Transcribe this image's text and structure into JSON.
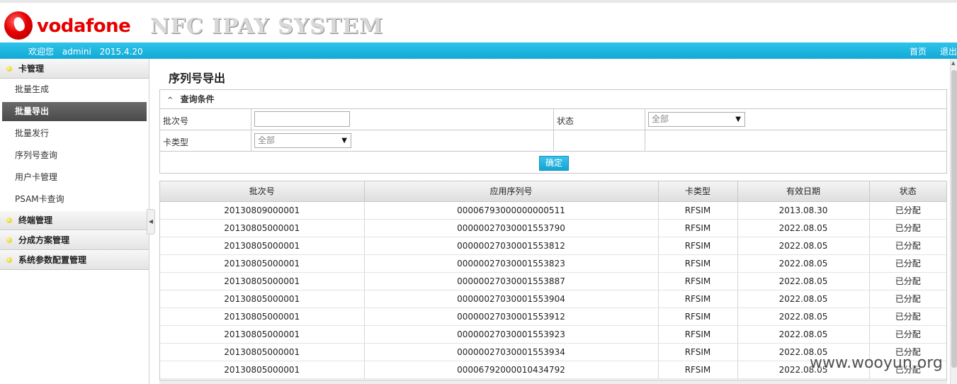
{
  "header": {
    "brand": "vodafone",
    "system_title": "NFC IPAY SYSTEM"
  },
  "topbar": {
    "welcome": "欢迎您",
    "user": "admini",
    "date": "2015.4.20",
    "home": "首页",
    "logout": "退出"
  },
  "sidebar": {
    "groups": [
      {
        "label": "卡管理",
        "items": [
          "批量生成",
          "批量导出",
          "批量发行",
          "序列号查询",
          "用户卡管理",
          "PSAM卡查询"
        ]
      },
      {
        "label": "终端管理"
      },
      {
        "label": "分成方案管理"
      },
      {
        "label": "系统参数配置管理"
      }
    ],
    "active_item": "批量导出"
  },
  "main": {
    "page_title": "序列号导出",
    "query": {
      "title": "查询条件",
      "batch_label": "批次号",
      "batch_value": "",
      "status_label": "状态",
      "status_value": "全部",
      "card_type_label": "卡类型",
      "card_type_value": "全部",
      "confirm": "确定"
    },
    "table": {
      "columns": [
        "批次号",
        "应用序列号",
        "卡类型",
        "有效日期",
        "状态"
      ],
      "rows": [
        [
          "20130809000001",
          "00006793000000000511",
          "RFSIM",
          "2013.08.30",
          "已分配"
        ],
        [
          "20130805000001",
          "00000027030001553790",
          "RFSIM",
          "2022.08.05",
          "已分配"
        ],
        [
          "20130805000001",
          "00000027030001553812",
          "RFSIM",
          "2022.08.05",
          "已分配"
        ],
        [
          "20130805000001",
          "00000027030001553823",
          "RFSIM",
          "2022.08.05",
          "已分配"
        ],
        [
          "20130805000001",
          "00000027030001553887",
          "RFSIM",
          "2022.08.05",
          "已分配"
        ],
        [
          "20130805000001",
          "00000027030001553904",
          "RFSIM",
          "2022.08.05",
          "已分配"
        ],
        [
          "20130805000001",
          "00000027030001553912",
          "RFSIM",
          "2022.08.05",
          "已分配"
        ],
        [
          "20130805000001",
          "00000027030001553923",
          "RFSIM",
          "2022.08.05",
          "已分配"
        ],
        [
          "20130805000001",
          "00000027030001553934",
          "RFSIM",
          "2022.08.05",
          "已分配"
        ],
        [
          "20130805000001",
          "00006792000010434792",
          "RFSIM",
          "2022.08.05",
          "已分配"
        ]
      ]
    }
  },
  "watermark": "www.wooyun.org",
  "colors": {
    "brand_red": "#e60000",
    "topbar_blue": "#1bb4e0"
  }
}
